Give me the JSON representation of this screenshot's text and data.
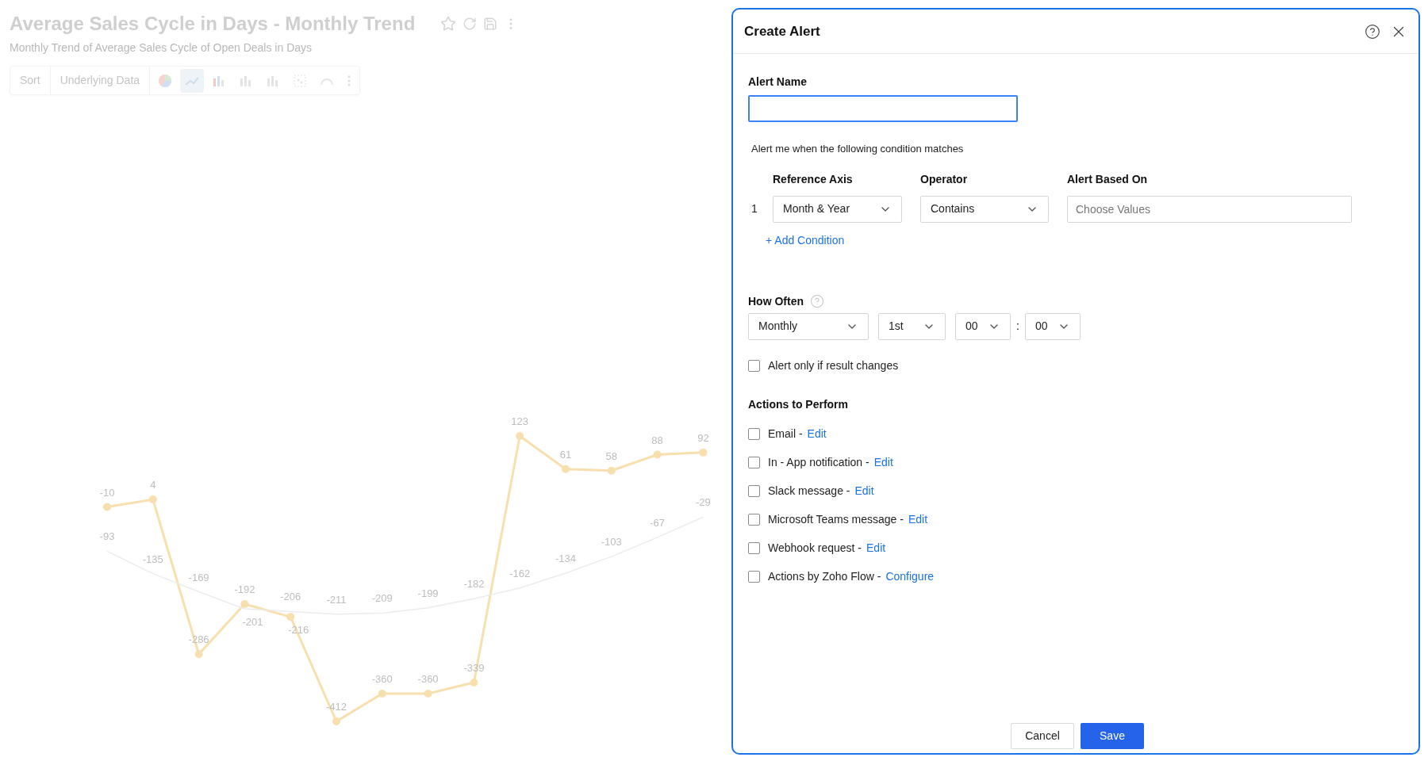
{
  "report": {
    "title": "Average Sales Cycle in Days - Monthly Trend",
    "subtitle": "Monthly Trend of Average Sales Cycle of Open Deals in Days",
    "toolbar": [
      {
        "label": "Sort"
      },
      {
        "label": "Underlying Data"
      }
    ],
    "chart_types": [
      {
        "kind": "pie",
        "selected": false
      },
      {
        "kind": "line",
        "selected": true
      },
      {
        "kind": "bar",
        "selected": false
      },
      {
        "kind": "bar",
        "selected": false
      },
      {
        "kind": "bar",
        "selected": false
      },
      {
        "kind": "scatter",
        "selected": false
      },
      {
        "kind": "gauge",
        "selected": false
      }
    ],
    "chart": {
      "chart_data": {
        "type": "line",
        "data_labels": true,
        "series": [
          {
            "marker": "circle",
            "color": "#f8dfae",
            "values": [
              -10,
              4,
              -286,
              -192,
              -216,
              -412,
              -360,
              -360,
              -339,
              123,
              61,
              58,
              88,
              92
            ]
          },
          {
            "color": "#ececec",
            "values": [
              -93,
              -135,
              -169,
              -201,
              -206,
              -211,
              -209,
              -199,
              -182,
              -162,
              -134,
              -103,
              -67,
              -29
            ]
          }
        ]
      }
    }
  },
  "dialog": {
    "title": "Create Alert",
    "alert_name_label": "Alert Name",
    "condition_intro": "Alert me when the following condition matches",
    "condition_columns": [
      "Reference Axis",
      "Operator",
      "Alert Based On"
    ],
    "conditions": [
      {
        "index": "1",
        "reference_axis": "Month & Year",
        "operator": "Contains",
        "placeholder": "Choose Values"
      }
    ],
    "add_condition": "+ Add Condition",
    "how_often": {
      "label": "How Often",
      "frequency": "Monthly",
      "day": "1st",
      "hour": "00",
      "separator": ":",
      "minute": "00"
    },
    "only_if_changes": {
      "label": "Alert only if result changes",
      "checked": false
    },
    "actions_title": "Actions to Perform",
    "actions": [
      {
        "label": "Email -",
        "link": "Edit",
        "checked": false
      },
      {
        "label": "In - App notification -",
        "link": "Edit",
        "checked": false
      },
      {
        "label": "Slack message -",
        "link": "Edit",
        "checked": false
      },
      {
        "label": "Microsoft Teams message -",
        "link": "Edit",
        "checked": false
      },
      {
        "label": "Webhook request -",
        "link": "Edit",
        "checked": false
      },
      {
        "label": "Actions by Zoho Flow -",
        "link": "Configure",
        "checked": false
      }
    ],
    "buttons": [
      {
        "label": "Cancel",
        "kind": "secondary"
      },
      {
        "label": "Save",
        "kind": "primary"
      }
    ]
  }
}
